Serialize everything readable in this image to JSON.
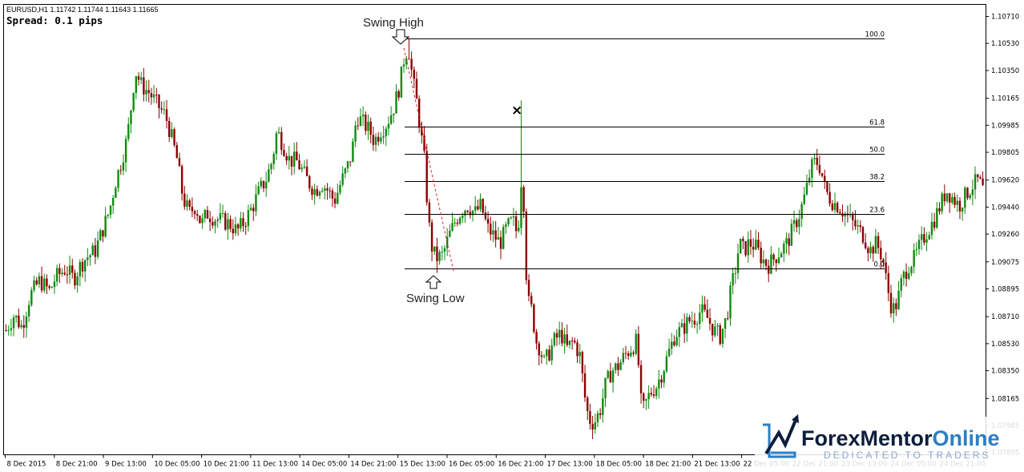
{
  "header": {
    "symbol_info": "EURUSD,H1  1.11742 1.11744 1.11643 1.11665",
    "spread": "Spread: 0.1 pips"
  },
  "annotations": {
    "swing_high": "Swing High",
    "swing_low": "Swing Low",
    "cross_mark": "×"
  },
  "logo": {
    "brand_part1": "Forex",
    "brand_part2": "Mentor",
    "brand_part3": "Online",
    "tagline": "DEDICATED TO TRADERS"
  },
  "colors": {
    "bull": "#0f8a0f",
    "bear": "#8b0000",
    "fib_line": "#000000",
    "trend_line": "#d62020",
    "logo_dark": "#0d1d3d",
    "logo_blue": "#2b7fc4"
  },
  "chart_data": {
    "type": "candlestick",
    "symbol": "EURUSD",
    "timeframe": "H1",
    "ylim": [
      1.0779,
      1.1079
    ],
    "y_ticks": [
      "1.10710",
      "1.10530",
      "1.10350",
      "1.10165",
      "1.09985",
      "1.09805",
      "1.09620",
      "1.09440",
      "1.09260",
      "1.09075",
      "1.08895",
      "1.08710",
      "1.08530",
      "1.08350",
      "1.08165",
      "1.07985",
      "1.07805"
    ],
    "x_ticks": [
      "8 Dec 2015",
      "8 Dec 21:00",
      "9 Dec 13:00",
      "10 Dec 05:00",
      "10 Dec 21:00",
      "11 Dec 13:00",
      "14 Dec 05:00",
      "14 Dec 21:00",
      "15 Dec 13:00",
      "16 Dec 05:00",
      "16 Dec 21:00",
      "17 Dec 13:00",
      "18 Dec 05:00",
      "18 Dec 21:00",
      "21 Dec 13:00",
      "22 Dec 05:00",
      "22 Dec 21:00",
      "23 Dec 13:00",
      "24 Dec 05:00",
      "24 Dec 21:00"
    ],
    "fibonacci": {
      "levels": [
        {
          "label": "100.0",
          "price": 1.10565
        },
        {
          "label": "61.8",
          "price": 1.09975
        },
        {
          "label": "50.0",
          "price": 1.09795
        },
        {
          "label": "38.2",
          "price": 1.09614
        },
        {
          "label": "23.6",
          "price": 1.09392
        },
        {
          "label": "0.0",
          "price": 1.09031
        }
      ]
    },
    "swing_high_price": 1.10565,
    "swing_low_price": 1.09031,
    "spike_high_price": 1.1015,
    "close_path": [
      [
        0,
        1.0862
      ],
      [
        10,
        1.0872
      ],
      [
        20,
        1.0864
      ],
      [
        30,
        1.0885
      ],
      [
        42,
        1.0895
      ],
      [
        55,
        1.0888
      ],
      [
        62,
        1.0897
      ],
      [
        75,
        1.0903
      ],
      [
        85,
        1.0896
      ],
      [
        92,
        1.0904
      ],
      [
        100,
        1.091
      ],
      [
        112,
        1.0915
      ],
      [
        122,
        1.093
      ],
      [
        130,
        1.0942
      ],
      [
        137,
        1.096
      ],
      [
        145,
        1.0975
      ],
      [
        152,
        1.099
      ],
      [
        158,
        1.1015
      ],
      [
        162,
        1.1035
      ],
      [
        170,
        1.1025
      ],
      [
        180,
        1.102
      ],
      [
        190,
        1.1012
      ],
      [
        200,
        1.1005
      ],
      [
        208,
        1.099
      ],
      [
        215,
        1.0975
      ],
      [
        222,
        1.095
      ],
      [
        230,
        1.094
      ],
      [
        238,
        1.0945
      ],
      [
        245,
        1.0932
      ],
      [
        252,
        1.094
      ],
      [
        260,
        1.0937
      ],
      [
        270,
        1.0935
      ],
      [
        280,
        1.0933
      ],
      [
        290,
        1.0928
      ],
      [
        300,
        1.0935
      ],
      [
        310,
        1.0945
      ],
      [
        318,
        1.0955
      ],
      [
        326,
        1.0962
      ],
      [
        334,
        1.0975
      ],
      [
        340,
        1.0995
      ],
      [
        348,
        1.0985
      ],
      [
        356,
        1.0975
      ],
      [
        364,
        1.0975
      ],
      [
        372,
        1.0968
      ],
      [
        380,
        1.096
      ],
      [
        388,
        1.0955
      ],
      [
        396,
        1.096
      ],
      [
        404,
        1.0955
      ],
      [
        412,
        1.0948
      ],
      [
        420,
        1.096
      ],
      [
        428,
        1.097
      ],
      [
        434,
        1.098
      ],
      [
        440,
        1.1005
      ],
      [
        448,
        1.1
      ],
      [
        456,
        1.0995
      ],
      [
        462,
        1.0988
      ],
      [
        470,
        1.0995
      ],
      [
        478,
        1.1
      ],
      [
        486,
        1.101
      ],
      [
        494,
        1.1025
      ],
      [
        500,
        1.1045
      ],
      [
        505,
        1.105
      ],
      [
        510,
        1.103
      ],
      [
        515,
        1.1015
      ],
      [
        520,
        1.0995
      ],
      [
        525,
        1.0975
      ],
      [
        530,
        1.0935
      ],
      [
        535,
        1.0915
      ],
      [
        540,
        1.091
      ],
      [
        548,
        1.0912
      ],
      [
        556,
        1.0925
      ],
      [
        564,
        1.0935
      ],
      [
        572,
        1.0942
      ],
      [
        580,
        1.0945
      ],
      [
        588,
        1.094
      ],
      [
        596,
        1.0945
      ],
      [
        604,
        1.093
      ],
      [
        612,
        1.0925
      ],
      [
        620,
        1.092
      ],
      [
        628,
        1.093
      ],
      [
        636,
        1.0935
      ],
      [
        642,
        1.0925
      ],
      [
        648,
        1.0975
      ],
      [
        652,
        1.0905
      ],
      [
        656,
        1.088
      ],
      [
        660,
        1.0875
      ],
      [
        665,
        1.0855
      ],
      [
        670,
        1.085
      ],
      [
        675,
        1.084
      ],
      [
        680,
        1.0845
      ],
      [
        688,
        1.0855
      ],
      [
        696,
        1.086
      ],
      [
        704,
        1.085
      ],
      [
        712,
        1.0855
      ],
      [
        720,
        1.0845
      ],
      [
        728,
        1.081
      ],
      [
        734,
        1.08
      ],
      [
        740,
        1.0802
      ],
      [
        746,
        1.081
      ],
      [
        752,
        1.0825
      ],
      [
        760,
        1.0835
      ],
      [
        768,
        1.0838
      ],
      [
        776,
        1.0845
      ],
      [
        784,
        1.085
      ],
      [
        792,
        1.0855
      ],
      [
        796,
        1.0815
      ],
      [
        800,
        1.081
      ],
      [
        808,
        1.082
      ],
      [
        816,
        1.0825
      ],
      [
        824,
        1.0835
      ],
      [
        832,
        1.0848
      ],
      [
        840,
        1.086
      ],
      [
        848,
        1.0862
      ],
      [
        856,
        1.0868
      ],
      [
        864,
        1.087
      ],
      [
        872,
        1.0875
      ],
      [
        880,
        1.087
      ],
      [
        888,
        1.0862
      ],
      [
        896,
        1.0858
      ],
      [
        904,
        1.087
      ],
      [
        910,
        1.089
      ],
      [
        916,
        1.0905
      ],
      [
        920,
        1.092
      ],
      [
        926,
        1.0915
      ],
      [
        932,
        1.092
      ],
      [
        940,
        1.0918
      ],
      [
        948,
        1.091
      ],
      [
        956,
        1.0905
      ],
      [
        964,
        1.091
      ],
      [
        972,
        1.0915
      ],
      [
        980,
        1.092
      ],
      [
        988,
        1.093
      ],
      [
        996,
        1.094
      ],
      [
        1004,
        1.0955
      ],
      [
        1010,
        1.097
      ],
      [
        1016,
        1.0975
      ],
      [
        1022,
        1.097
      ],
      [
        1028,
        1.0955
      ],
      [
        1036,
        1.0948
      ],
      [
        1044,
        1.0945
      ],
      [
        1052,
        1.094
      ],
      [
        1060,
        1.0935
      ],
      [
        1068,
        1.093
      ],
      [
        1076,
        1.0925
      ],
      [
        1084,
        1.0915
      ],
      [
        1092,
        1.092
      ],
      [
        1100,
        1.091
      ],
      [
        1106,
        1.089
      ],
      [
        1112,
        1.0875
      ],
      [
        1118,
        1.088
      ],
      [
        1124,
        1.0895
      ],
      [
        1132,
        1.0905
      ],
      [
        1140,
        1.091
      ],
      [
        1148,
        1.092
      ],
      [
        1156,
        1.0928
      ],
      [
        1164,
        1.0935
      ],
      [
        1172,
        1.0945
      ],
      [
        1180,
        1.0955
      ],
      [
        1188,
        1.095
      ],
      [
        1196,
        1.0945
      ],
      [
        1204,
        1.0952
      ],
      [
        1212,
        1.0958
      ],
      [
        1220,
        1.0962
      ],
      [
        1226,
        1.0955
      ]
    ]
  }
}
